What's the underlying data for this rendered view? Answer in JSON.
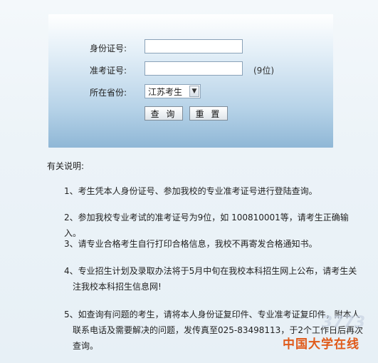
{
  "form": {
    "id_label": "身份证号:",
    "ticket_label": "准考证号:",
    "ticket_hint": "(9位)",
    "province_label": "所在省份:",
    "province_value": "江苏考生",
    "query_button": "查 询",
    "reset_button": "重 置",
    "id_value": "",
    "ticket_value": ""
  },
  "notes": {
    "title": "有关说明:",
    "items": [
      {
        "line1": "1、考生凭本人身份证号、参加我校的专业准考证号进行登陆查询。",
        "line2": ""
      },
      {
        "line1": "2、参加我校专业考试的准考证号为9位，如 100810001等，请考生正确输入。",
        "line2": ""
      },
      {
        "line1": "3、请专业合格考生自行打印合格信息，我校不再寄发合格通知书。",
        "line2": ""
      },
      {
        "line1": "4、专业招生计划及录取办法将于5月中旬在我校本科招生网上公布，请考生关",
        "line2": "注我校本科招生信息网!"
      },
      {
        "line1": "5、如查询有问题的考生，请将本人身份证复印件、专业准考证复印件，附本人",
        "line2": "联系电话及需要解决的问题，发传真至025-83498113，于2个工作日后再次查询。"
      }
    ]
  },
  "watermark": {
    "number": "3773",
    "text": "中国大学在线"
  }
}
